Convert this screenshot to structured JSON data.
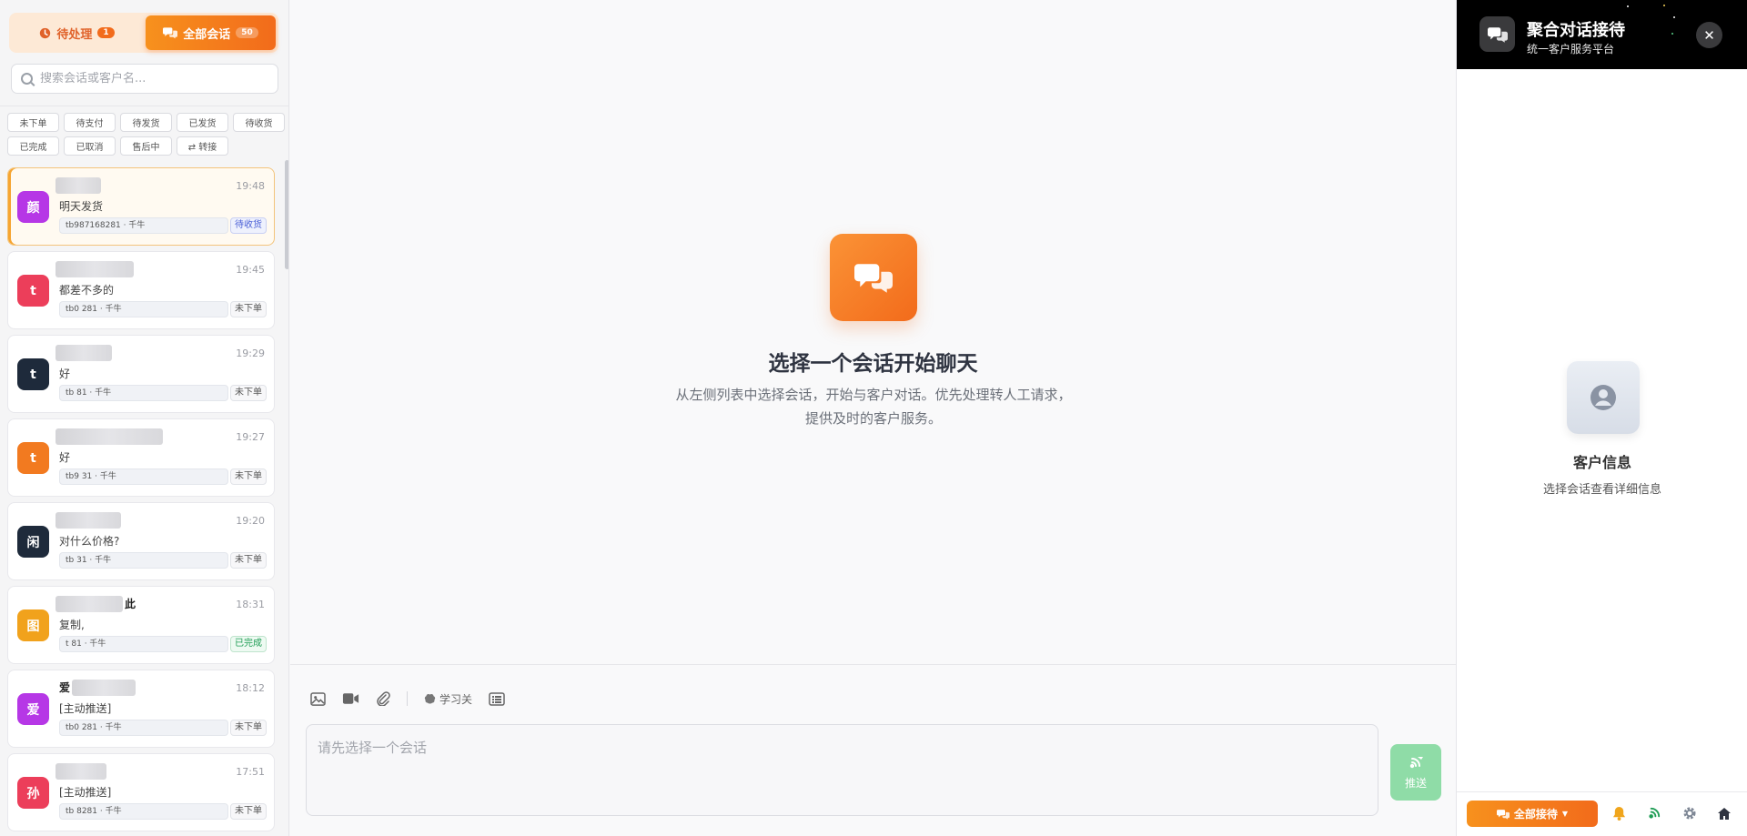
{
  "sidebar": {
    "tabs": {
      "pending_label": "待处理",
      "pending_count": "1",
      "all_label": "全部会话",
      "all_count": "50"
    },
    "search_placeholder": "搜索会话或客户名...",
    "filters": [
      "未下单",
      "待支付",
      "待发货",
      "已发货",
      "待收货",
      "已完成",
      "已取消",
      "售后中",
      "⇄ 转接"
    ],
    "conversations": [
      {
        "avatar": "颜",
        "avatar_color": "#b637e6",
        "name_tail": "",
        "time": "19:48",
        "message": "明天发货",
        "meta": "tb987168281 · 千牛",
        "status": "待收货",
        "status_type": "wait"
      },
      {
        "avatar": "t",
        "avatar_color": "#ec3e5a",
        "name_tail": "",
        "time": "19:45",
        "message": "都差不多的",
        "meta": "tb0      281 · 千牛",
        "status": "未下单",
        "status_type": "none"
      },
      {
        "avatar": "t",
        "avatar_color": "#1e2a3b",
        "name_tail": "",
        "time": "19:29",
        "message": "好",
        "meta": "tb       81 · 千牛",
        "status": "未下单",
        "status_type": "none"
      },
      {
        "avatar": "t",
        "avatar_color": "#f27a20",
        "name_tail": "",
        "time": "19:27",
        "message": "好",
        "meta": "tb9      31 · 千牛",
        "status": "未下单",
        "status_type": "none"
      },
      {
        "avatar": "闲",
        "avatar_color": "#1e2a3b",
        "name_tail": "",
        "time": "19:20",
        "message": "对什么价格?",
        "meta": "tb       31 · 千牛",
        "status": "未下单",
        "status_type": "none"
      },
      {
        "avatar": "图",
        "avatar_color": "#f1a21c",
        "name_tail": "此",
        "time": "18:31",
        "message": "复制,",
        "meta": "t       81 · 千牛",
        "status": "已完成",
        "status_type": "done"
      },
      {
        "avatar": "爱",
        "avatar_color": "#b637e6",
        "name_tail": "爱",
        "time": "18:12",
        "message": "[主动推送]",
        "meta": "tb0      281 · 千牛",
        "status": "未下单",
        "status_type": "none"
      },
      {
        "avatar": "孙",
        "avatar_color": "#ec3e5a",
        "name_tail": "",
        "time": "17:51",
        "message": "[主动推送]",
        "meta": "tb      8281 · 千牛",
        "status": "未下单",
        "status_type": "none"
      }
    ]
  },
  "main": {
    "empty_title": "选择一个会话开始聊天",
    "empty_desc": "从左侧列表中选择会话，开始与客户对话。优先处理转人工请求，提供及时的客户服务。",
    "toolbar": {
      "learn_label": "学习关"
    },
    "input_placeholder": "请先选择一个会话",
    "send_label": "推送"
  },
  "right_panel": {
    "title": "聚合对话接待",
    "subtitle": "统一客户服务平台",
    "customer_info_title": "客户信息",
    "customer_info_desc": "选择会话查看详细信息",
    "reception_label": "全部接待"
  },
  "colors": {
    "accent": "#f26b1b",
    "send_disabled": "#8fdca7"
  }
}
